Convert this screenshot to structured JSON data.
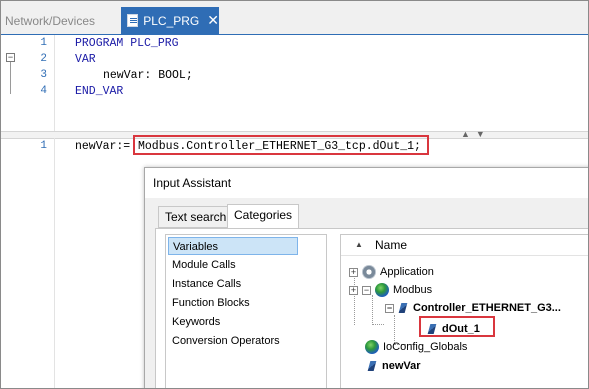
{
  "tabs": {
    "inactive_label": "Network/Devices",
    "active_label": "PLC_PRG",
    "close_glyph": "✕"
  },
  "declaration": {
    "lines": [
      {
        "num": "1",
        "text": "PROGRAM PLC_PRG"
      },
      {
        "num": "2",
        "text": "VAR"
      },
      {
        "num": "3",
        "text": "newVar: BOOL;"
      },
      {
        "num": "4",
        "text": "END_VAR"
      }
    ]
  },
  "implementation": {
    "line_num": "1",
    "lhs": "newVar:=",
    "expression": "Modbus.Controller_ETHERNET_G3_tcp.dOut_1;"
  },
  "dialog": {
    "title": "Input Assistant",
    "tabs": [
      "Text search",
      "Categories"
    ],
    "categories": [
      "Variables",
      "Module Calls",
      "Instance Calls",
      "Function Blocks",
      "Keywords",
      "Conversion Operators"
    ],
    "selected_category": "Variables",
    "tree_header": "Name",
    "tree": {
      "application": "Application",
      "modbus": "Modbus",
      "controller": "Controller_ETHERNET_G3...",
      "dout": "dOut_1",
      "ioconfig": "IoConfig_Globals",
      "newvar": "newVar"
    }
  },
  "colors": {
    "accent": "#2f6db5",
    "highlight_red": "#d9363e",
    "selection": "#cce4f7"
  }
}
